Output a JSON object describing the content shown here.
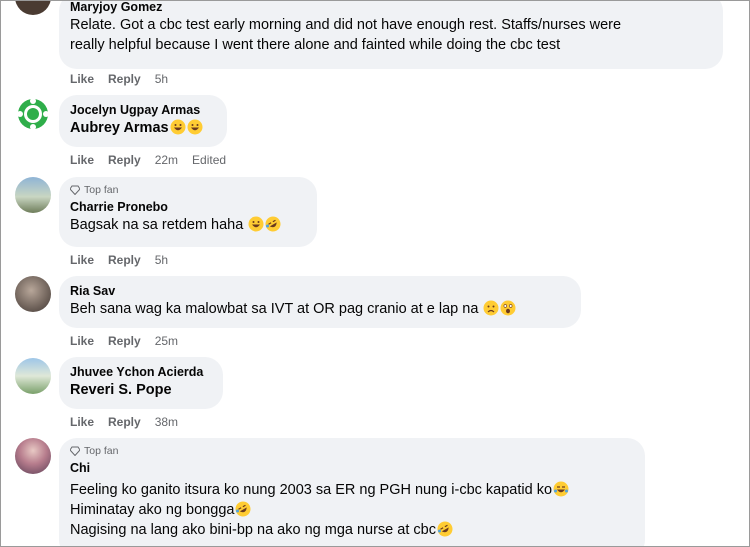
{
  "comments": [
    {
      "author": "Maryjoy Gomez",
      "lines": [
        "Relate. Got a cbc test early morning and did not have enough rest. Staffs/nurses were",
        "really helpful because I went there alone and fainted while doing the cbc test"
      ],
      "like": "Like",
      "reply": "Reply",
      "time": "5h"
    },
    {
      "author": "Jocelyn Ugpay Armas",
      "mention": "Aubrey Armas",
      "like": "Like",
      "reply": "Reply",
      "time": "22m",
      "edited": "Edited"
    },
    {
      "badge": "Top fan",
      "author": "Charrie Pronebo",
      "text": "Bagsak na sa retdem haha",
      "like": "Like",
      "reply": "Reply",
      "time": "5h"
    },
    {
      "author": "Ria Sav",
      "text": "Beh sana wag ka malowbat sa IVT at OR pag cranio at e lap na",
      "like": "Like",
      "reply": "Reply",
      "time": "25m"
    },
    {
      "author": "Jhuvee Ychon Acierda",
      "mention": "Reveri S. Pope",
      "like": "Like",
      "reply": "Reply",
      "time": "38m"
    },
    {
      "badge": "Top fan",
      "author": "Chi",
      "lines": [
        "Feeling ko ganito itsura ko nung 2003 sa ER ng PGH nung i-cbc kapatid ko",
        "Himinatay ako ng bongga",
        "Nagising na lang ako bini-bp na ako ng mga nurse at cbc"
      ]
    }
  ],
  "colors": {
    "bubble": "#f0f2f5",
    "meta": "#65676b",
    "text": "#050505"
  },
  "icons": [
    "grinning-face-icon",
    "rofl-face-icon",
    "worried-face-icon",
    "astonished-face-icon",
    "diamond-icon"
  ]
}
